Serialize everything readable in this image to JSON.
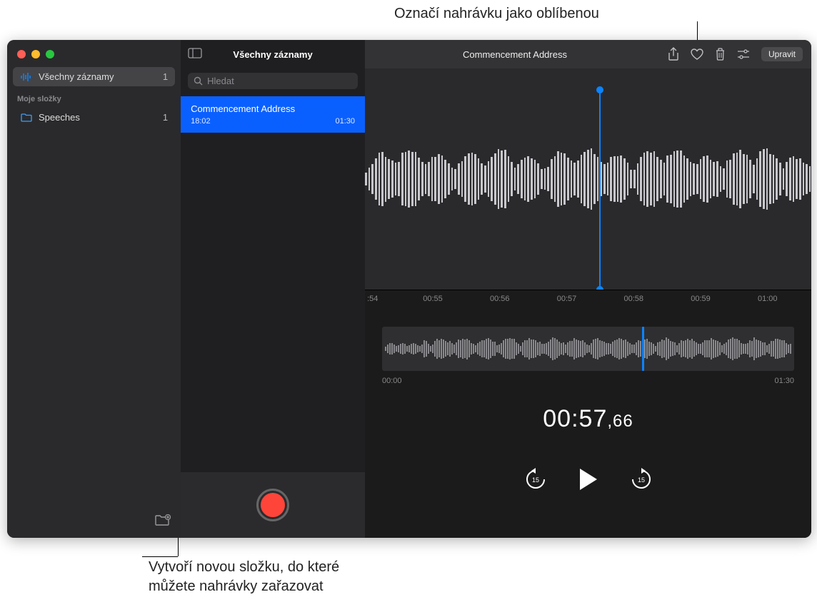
{
  "callouts": {
    "top": "Označí nahrávku jako oblíbenou",
    "bottom_line1": "Vytvoří novou složku, do které",
    "bottom_line2": "můžete nahrávky zařazovat"
  },
  "toolbar": {
    "title": "Commencement Address",
    "edit_label": "Upravit"
  },
  "sidebar": {
    "all_label": "Všechny záznamy",
    "all_count": "1",
    "section_header": "Moje složky",
    "folders": [
      {
        "name": "Speeches",
        "count": "1"
      }
    ]
  },
  "list": {
    "header": "Všechny záznamy",
    "search_placeholder": "Hledat",
    "items": [
      {
        "title": "Commencement Address",
        "time": "18:02",
        "duration": "01:30"
      }
    ]
  },
  "ruler": {
    "ticks": [
      ":54",
      "00:55",
      "00:56",
      "00:57",
      "00:58",
      "00:59",
      "01:00"
    ]
  },
  "overview": {
    "start": "00:00",
    "end": "01:30"
  },
  "timecode": {
    "main": "00:57",
    "ms": ",66"
  },
  "transport": {
    "back_secs": "15",
    "fwd_secs": "15"
  },
  "colors": {
    "accent": "#0a84ff"
  }
}
